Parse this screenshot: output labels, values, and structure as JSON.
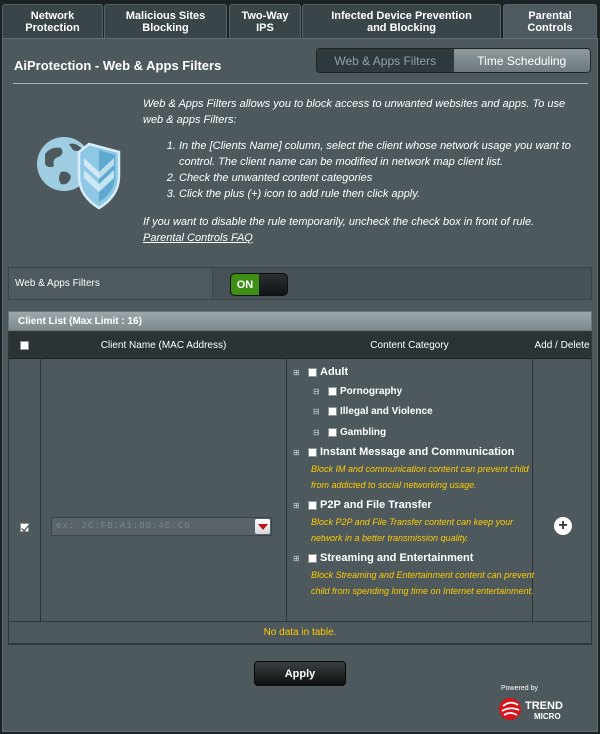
{
  "tabs": [
    {
      "label": "Network Protection",
      "active": false
    },
    {
      "label": "Malicious Sites Blocking",
      "active": false
    },
    {
      "label": "Two-Way IPS",
      "active": false
    },
    {
      "label": "Infected Device Prevention and Blocking",
      "active": false
    },
    {
      "label": "Parental Controls",
      "active": true
    }
  ],
  "page": {
    "title": "AiProtection - Web & Apps Filters",
    "segment": {
      "selected": "Web & Apps Filters",
      "other": "Time Scheduling"
    }
  },
  "description": {
    "intro": "Web & Apps Filters allows you to block access to unwanted websites and apps. To use web & apps Filters:",
    "steps": [
      "In the [Clients Name] column, select the client whose network usage you want to control. The client name can be modified in network map client list.",
      "Check the unwanted content categories",
      "Click the plus (+) icon to add rule then click apply."
    ],
    "disable_note": "If you want to disable the rule temporarily, uncheck the check box in front of rule.",
    "faq_link": "Parental Controls FAQ"
  },
  "filter_toggle": {
    "label": "Web & Apps Filters",
    "state": "ON"
  },
  "client_list": {
    "title": "Client List (Max Limit : 16)",
    "columns": {
      "client": "Client Name (MAC Address)",
      "category": "Content Category",
      "action": "Add / Delete"
    },
    "row": {
      "checked": true,
      "client_value": "ex: 2C:FD:A1:00:4E:C0",
      "categories": [
        {
          "name": "Adult",
          "checked": false,
          "subs": [
            {
              "name": "Pornography",
              "checked": false
            },
            {
              "name": "Illegal and Violence",
              "checked": false
            },
            {
              "name": "Gambling",
              "checked": false
            }
          ]
        },
        {
          "name": "Instant Message and Communication",
          "checked": false,
          "note": "Block IM and communication content can prevent child from addicted to social networking usage."
        },
        {
          "name": "P2P and File Transfer",
          "checked": false,
          "note": "Block P2P and File Transfer content can keep your network in a better transmission quality."
        },
        {
          "name": "Streaming and Entertainment",
          "checked": false,
          "note": "Block Streaming and Entertainment content can prevent child from spending long time on Internet entertainment."
        }
      ]
    },
    "empty_text": "No data in table."
  },
  "apply_label": "Apply",
  "footer": {
    "powered_by": "Powered by",
    "brand_line1": "TREND",
    "brand_line2": "MICRO"
  },
  "colors": {
    "accent_yellow": "#ffcc00",
    "toggle_on": "#3f8f16",
    "brand_red": "#d7141c"
  }
}
